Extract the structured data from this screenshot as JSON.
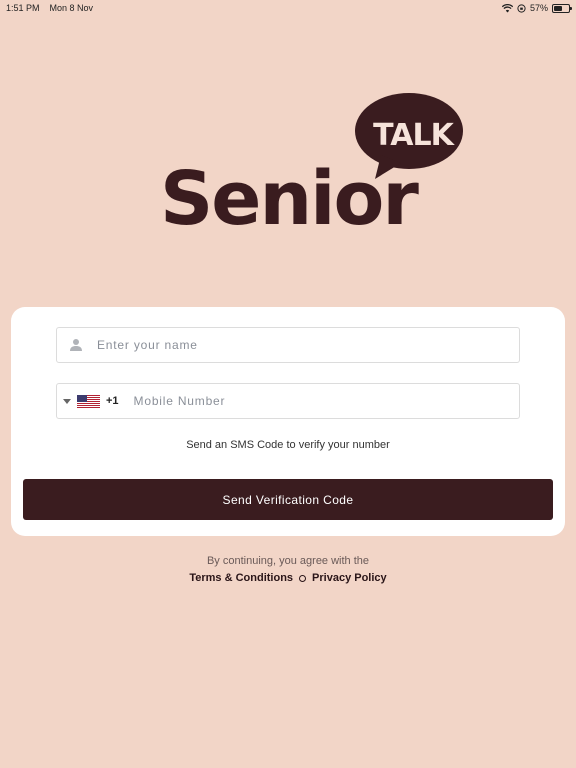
{
  "status_bar": {
    "time": "1:51 PM",
    "date": "Mon 8 Nov",
    "battery": "57%",
    "battery_level": 0.57
  },
  "logo": {
    "bubble_text": "TALK",
    "wordmark": "Senior",
    "primary_color": "#3a1c1f",
    "background_color": "#f2d5c7"
  },
  "form": {
    "name_placeholder": "Enter your name",
    "name_value": "",
    "country_code": "+1",
    "phone_placeholder": "Mobile Number",
    "phone_value": "",
    "helper_text": "Send an SMS Code to verify your number",
    "submit_label": "Send Verification Code"
  },
  "footer": {
    "agree_text": "By continuing, you agree with the",
    "terms_label": "Terms & Conditions",
    "privacy_label": "Privacy Policy"
  }
}
